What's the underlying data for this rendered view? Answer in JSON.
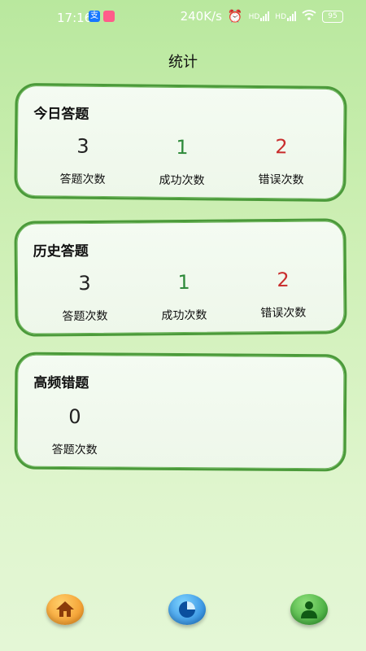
{
  "status_bar": {
    "time": "17:16",
    "network_speed": "240K/s",
    "signal_label_1": "HD",
    "signal_label_2": "HD",
    "battery": "95"
  },
  "page": {
    "title": "统计"
  },
  "today": {
    "title": "今日答题",
    "answers": {
      "value": "3",
      "label": "答题次数"
    },
    "success": {
      "value": "1",
      "label": "成功次数"
    },
    "errors": {
      "value": "2",
      "label": "错误次数"
    }
  },
  "history": {
    "title": "历史答题",
    "answers": {
      "value": "3",
      "label": "答题次数"
    },
    "success": {
      "value": "1",
      "label": "成功次数"
    },
    "errors": {
      "value": "2",
      "label": "错误次数"
    }
  },
  "frequent_errors": {
    "title": "高频错题",
    "answers": {
      "value": "0",
      "label": "答题次数"
    }
  },
  "bottom_nav": {
    "items": [
      {
        "icon": "home-icon"
      },
      {
        "icon": "pie-chart-icon"
      },
      {
        "icon": "user-icon"
      }
    ]
  },
  "colors": {
    "success": "#2e8a3a",
    "error": "#c92e2e",
    "card_border": "#4b9a3a"
  }
}
